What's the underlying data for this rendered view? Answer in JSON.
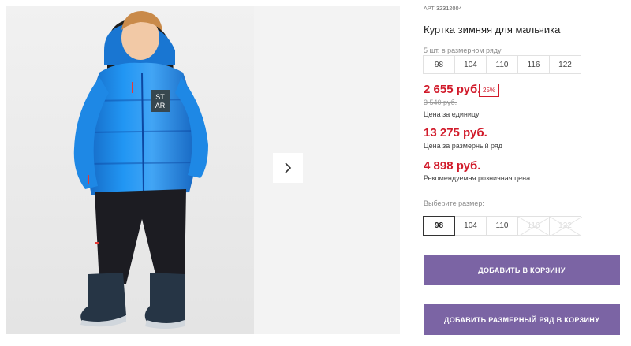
{
  "product": {
    "article_label": "АРТ",
    "article_number": "32312004",
    "title": "Куртка зимняя для мальчика"
  },
  "size_set": {
    "label": "5 шт. в размерном ряду",
    "sizes": [
      "98",
      "104",
      "110",
      "116",
      "122"
    ]
  },
  "prices": {
    "unit_price": "2 655 руб.",
    "discount": "25%",
    "old_price": "3 540 руб.",
    "unit_label": "Цена за единицу",
    "set_price": "13 275 руб.",
    "set_label": "Цена за размерный ряд",
    "rrp_price": "4 898 руб.",
    "rrp_label": "Рекомендуемая розничная цена"
  },
  "size_picker": {
    "label": "Выберите размер:",
    "options": [
      {
        "label": "98",
        "state": "selected"
      },
      {
        "label": "104",
        "state": "available"
      },
      {
        "label": "110",
        "state": "available"
      },
      {
        "label": "116",
        "state": "disabled"
      },
      {
        "label": "122",
        "state": "disabled"
      }
    ]
  },
  "buttons": {
    "add_to_cart": "ДОБАВИТЬ В КОРЗИНУ",
    "add_set_to_cart": "ДОБАВИТЬ РАЗМЕРНЫЙ РЯД В КОРЗИНУ"
  },
  "gallery": {
    "jacket_badge_line1": "ST",
    "jacket_badge_line2": "AR",
    "next_icon": "chevron-right-icon"
  },
  "colors": {
    "price_red": "#d11a2a",
    "button_purple": "#7b64a4",
    "jacket_blue": "#1e88e5"
  }
}
